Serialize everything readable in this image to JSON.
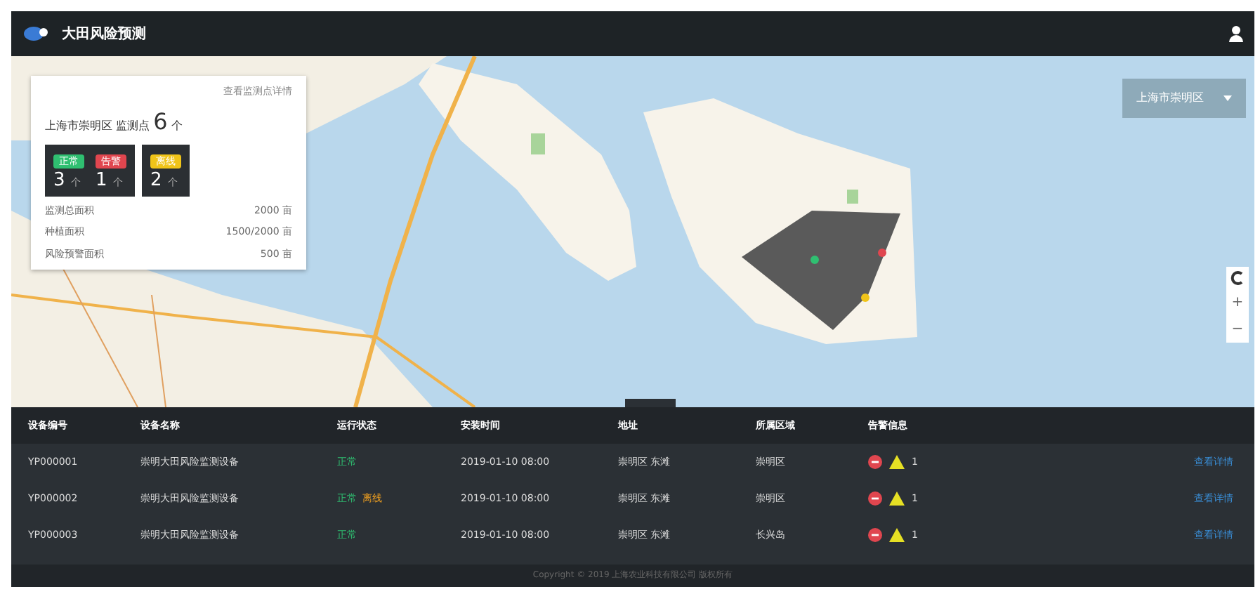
{
  "header": {
    "title": "大田风险预测"
  },
  "summary_panel": {
    "link": "查看监测点详情",
    "heading_prefix": "上海市崇明区 监测点",
    "count": "6",
    "count_unit": "个",
    "groups": [
      {
        "items": [
          {
            "label": "正常",
            "count": "3",
            "unit": "个",
            "color": "#2fbf71"
          },
          {
            "label": "告警",
            "count": "1",
            "unit": "个",
            "color": "#e0464f"
          }
        ]
      },
      {
        "items": [
          {
            "label": "离线",
            "count": "2",
            "unit": "个",
            "color": "#f0c419"
          }
        ]
      }
    ],
    "stats": [
      {
        "label": "监测总面积",
        "value": "2000 亩"
      },
      {
        "label": "种植面积",
        "value": "1500/2000 亩"
      },
      {
        "label": "风险预警面积",
        "value": "500 亩"
      }
    ]
  },
  "region_select": {
    "value": "上海市崇明区"
  },
  "map_controls": [
    "+",
    "−"
  ],
  "table": {
    "columns": [
      "设备编号",
      "设备名称",
      "运行状态",
      "安装时间",
      "地址",
      "所属区域",
      "告警信息"
    ],
    "rows": [
      {
        "device_id": "YP000001",
        "device_name": "崇明大田风险监测设备",
        "statuses": [
          {
            "label": "正常",
            "kind": "ok"
          }
        ],
        "install_time": "2019-01-10 08:00",
        "address": "崇明区 东滩",
        "region": "崇明区",
        "warning_count": "1",
        "action": "查看详情"
      },
      {
        "device_id": "YP000002",
        "device_name": "崇明大田风险监测设备",
        "statuses": [
          {
            "label": "正常",
            "kind": "ok"
          },
          {
            "label": "离线",
            "kind": "offline"
          }
        ],
        "install_time": "2019-01-10 08:00",
        "address": "崇明区 东滩",
        "region": "崇明区",
        "warning_count": "1",
        "action": "查看详情"
      },
      {
        "device_id": "YP000003",
        "device_name": "崇明大田风险监测设备",
        "statuses": [
          {
            "label": "正常",
            "kind": "ok"
          }
        ],
        "install_time": "2019-01-10 08:00",
        "address": "崇明区 东滩",
        "region": "长兴岛",
        "warning_count": "1",
        "action": "查看详情"
      }
    ]
  },
  "footer": {
    "text": "Copyright © 2019 上海农业科技有限公司 版权所有"
  }
}
